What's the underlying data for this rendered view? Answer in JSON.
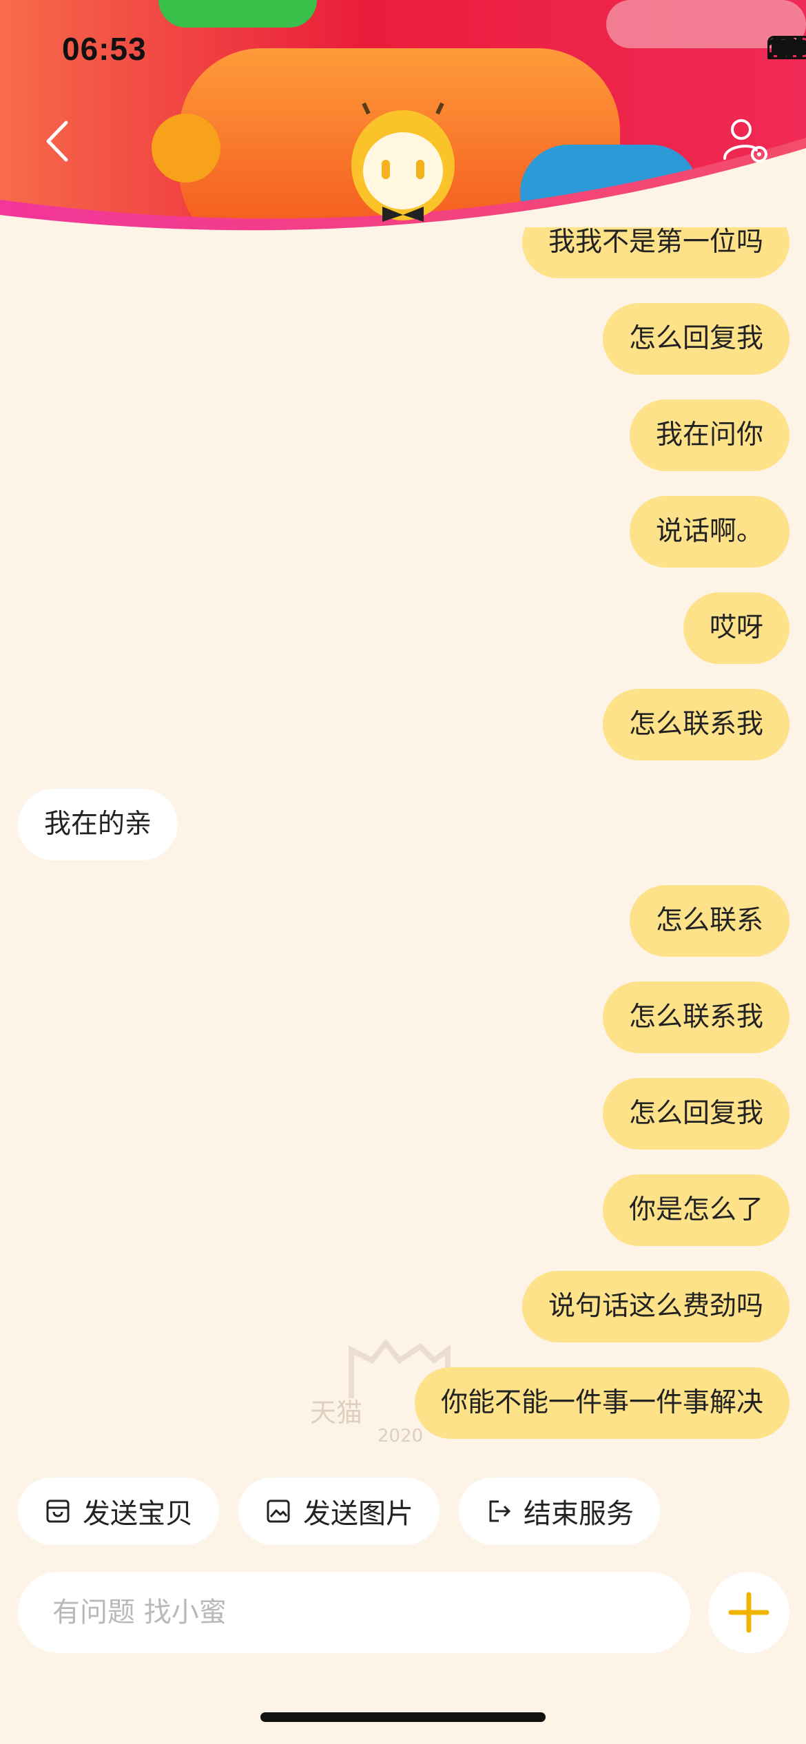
{
  "status_bar": {
    "time": "06:53"
  },
  "messages": [
    {
      "dir": "out",
      "text": "我我不是第一位吗"
    },
    {
      "dir": "out",
      "text": "怎么回复我"
    },
    {
      "dir": "out",
      "text": "我在问你"
    },
    {
      "dir": "out",
      "text": "说话啊。"
    },
    {
      "dir": "out",
      "text": "哎呀"
    },
    {
      "dir": "out",
      "text": "怎么联系我"
    },
    {
      "dir": "in",
      "text": "我在的亲"
    },
    {
      "dir": "out",
      "text": "怎么联系"
    },
    {
      "dir": "out",
      "text": "怎么联系我"
    },
    {
      "dir": "out",
      "text": "怎么回复我"
    },
    {
      "dir": "out",
      "text": "你是怎么了"
    },
    {
      "dir": "out",
      "text": "说句话这么费劲吗"
    },
    {
      "dir": "out",
      "text": "你能不能一件事一件事解决"
    }
  ],
  "watermark": {
    "text": "天猫",
    "year": "2020"
  },
  "quick_actions": [
    {
      "label": "发送宝贝",
      "icon": "bag-icon"
    },
    {
      "label": "发送图片",
      "icon": "image-icon"
    },
    {
      "label": "结束服务",
      "icon": "exit-icon"
    }
  ],
  "input": {
    "placeholder": "有问题 找小蜜",
    "value": ""
  },
  "colors": {
    "accent": "#f0b400",
    "outgoing_bubble": "#fde28a",
    "background": "#fdf3e7"
  }
}
